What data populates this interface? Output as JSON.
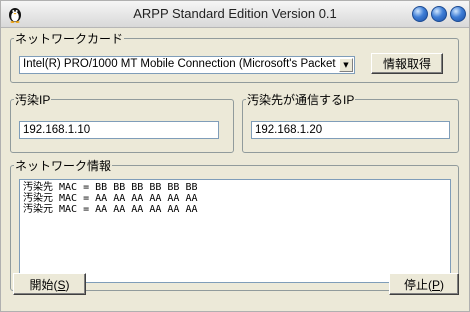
{
  "window": {
    "title": "ARPP Standard Edition Version 0.1",
    "app_icon": "penguin-icon",
    "buttons": [
      "minimize-button",
      "maximize-button",
      "close-button"
    ]
  },
  "nic_group": {
    "label": "ネットワークカード",
    "selected": "Intel(R) PRO/1000 MT Mobile Connection (Microsoft's Packet",
    "fetch_button": "情報取得"
  },
  "target_group": {
    "label": "汚染IP",
    "value": "192.168.1.10"
  },
  "dest_group": {
    "label": "汚染先が通信するIP",
    "value": "192.168.1.20"
  },
  "info_group": {
    "label": "ネットワーク情報",
    "lines": [
      "汚染先 MAC = BB BB BB BB BB BB",
      "汚染元 MAC = AA AA AA AA AA AA",
      "汚染元 MAC = AA AA AA AA AA AA"
    ]
  },
  "actions": {
    "start": "開始(",
    "start_key": "S",
    "stop": "停止(",
    "stop_key": "P"
  },
  "colors": {
    "face": "#ece9d8",
    "border": "#919b9c",
    "button_blue": "#3f7ed6"
  }
}
